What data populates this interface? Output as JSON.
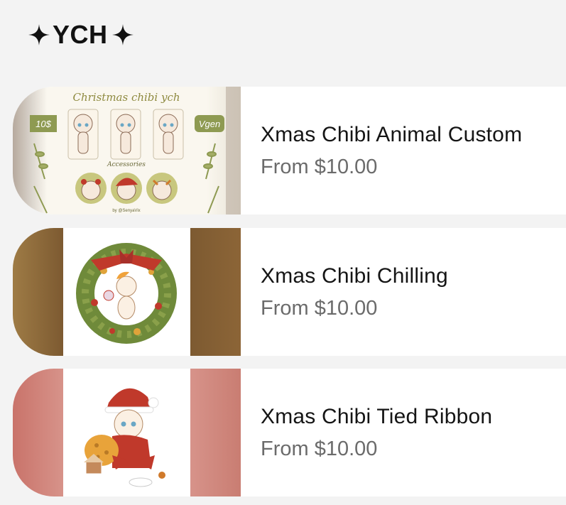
{
  "section": {
    "title": "YCH",
    "sparkle_icon": "four-point-star-icon"
  },
  "products": [
    {
      "name": "Xmas Chibi Animal Custom",
      "price": "From $10.00",
      "thumb": {
        "heading": "Christmas chibi ych",
        "price_tag": "10$",
        "vgen_tag": "Vgen",
        "subheading": "Accessories",
        "credit": "by @SenyaVix"
      }
    },
    {
      "name": "Xmas Chibi Chilling",
      "price": "From $10.00",
      "thumb": {
        "colors": {
          "side": "#8b6436",
          "wreath": "#6f8a3a",
          "bow": "#c0392b"
        }
      }
    },
    {
      "name": "Xmas Chibi Tied Ribbon",
      "price": "From $10.00",
      "thumb": {
        "colors": {
          "side": "#c4756b",
          "hat": "#c0392b"
        }
      }
    }
  ]
}
